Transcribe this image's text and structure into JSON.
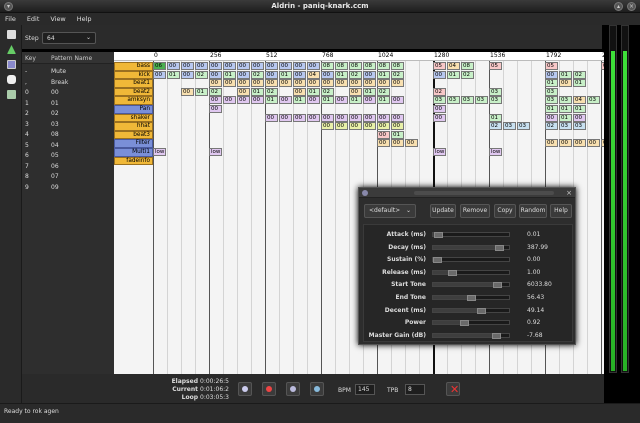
{
  "window": {
    "title": "Aldrin - paniq-knark.ccm"
  },
  "menu": [
    "File",
    "Edit",
    "View",
    "Help"
  ],
  "step": {
    "label": "Step",
    "value": "64"
  },
  "pattern_list": {
    "headers": {
      "key": "Key",
      "name": "Pattern Name"
    },
    "rows": [
      {
        "key": "-",
        "name": "Mute"
      },
      {
        "key": ",",
        "name": "Break"
      },
      {
        "key": "0",
        "name": "00"
      },
      {
        "key": "1",
        "name": "01"
      },
      {
        "key": "2",
        "name": "02"
      },
      {
        "key": "3",
        "name": "03"
      },
      {
        "key": "4",
        "name": "08"
      },
      {
        "key": "5",
        "name": "04"
      },
      {
        "key": "6",
        "name": "05"
      },
      {
        "key": "7",
        "name": "06"
      },
      {
        "key": "8",
        "name": "07"
      },
      {
        "key": "9",
        "name": "09"
      }
    ]
  },
  "ruler": [
    "0",
    "256",
    "512",
    "768",
    "1024",
    "1280",
    "1536",
    "1792",
    "20"
  ],
  "tracks": [
    {
      "name": "bass",
      "style": "orange"
    },
    {
      "name": "kick",
      "style": "orange"
    },
    {
      "name": "beat1",
      "style": "orange"
    },
    {
      "name": "beat2",
      "style": "orange"
    },
    {
      "name": "amksyn",
      "style": "orange"
    },
    {
      "name": "Pan",
      "style": "blue"
    },
    {
      "name": "shaker",
      "style": "orange"
    },
    {
      "name": "hhat",
      "style": "orange"
    },
    {
      "name": "beat3",
      "style": "orange"
    },
    {
      "name": "Filter",
      "style": "blue"
    },
    {
      "name": "Multi1",
      "style": "blue"
    },
    {
      "name": "fadeinfo",
      "style": "orange"
    }
  ],
  "cells": [
    {
      "t": 0,
      "c": 0,
      "v": "06",
      "col": "#4caf50"
    },
    {
      "t": 0,
      "c": 1,
      "v": "00",
      "col": "#b8c8f0"
    },
    {
      "t": 0,
      "c": 2,
      "v": "00",
      "col": "#b8c8f0"
    },
    {
      "t": 0,
      "c": 3,
      "v": "00",
      "col": "#b8c8f0"
    },
    {
      "t": 0,
      "c": 4,
      "v": "00",
      "col": "#b8c8f0"
    },
    {
      "t": 0,
      "c": 5,
      "v": "00",
      "col": "#b8c8f0"
    },
    {
      "t": 0,
      "c": 6,
      "v": "00",
      "col": "#b8c8f0"
    },
    {
      "t": 0,
      "c": 7,
      "v": "00",
      "col": "#b8c8f0"
    },
    {
      "t": 0,
      "c": 8,
      "v": "00",
      "col": "#b8c8f0"
    },
    {
      "t": 0,
      "c": 9,
      "v": "00",
      "col": "#b8c8f0"
    },
    {
      "t": 0,
      "c": 10,
      "v": "00",
      "col": "#b8c8f0"
    },
    {
      "t": 0,
      "c": 11,
      "v": "00",
      "col": "#b8c8f0"
    },
    {
      "t": 0,
      "c": 12,
      "v": "08",
      "col": "#c8f0c8"
    },
    {
      "t": 0,
      "c": 13,
      "v": "08",
      "col": "#c8f0c8"
    },
    {
      "t": 0,
      "c": 14,
      "v": "08",
      "col": "#c8f0c8"
    },
    {
      "t": 0,
      "c": 15,
      "v": "08",
      "col": "#c8f0c8"
    },
    {
      "t": 0,
      "c": 16,
      "v": "08",
      "col": "#c8f0c8"
    },
    {
      "t": 0,
      "c": 17,
      "v": "08",
      "col": "#c8f0c8"
    },
    {
      "t": 0,
      "c": 20,
      "v": "05",
      "col": "#f8c8c8"
    },
    {
      "t": 0,
      "c": 21,
      "v": "04",
      "col": "#f8e0b0"
    },
    {
      "t": 0,
      "c": 22,
      "v": "08",
      "col": "#c8f0c8"
    },
    {
      "t": 0,
      "c": 24,
      "v": "05",
      "col": "#f8c8c8"
    },
    {
      "t": 0,
      "c": 28,
      "v": "05",
      "col": "#f8c8c8"
    },
    {
      "t": 0,
      "c": 32,
      "v": "05",
      "col": "#f8c8c8"
    },
    {
      "t": 1,
      "c": 0,
      "v": "00",
      "col": "#b8c8f0"
    },
    {
      "t": 1,
      "c": 1,
      "v": "01",
      "col": "#c8f0c8"
    },
    {
      "t": 1,
      "c": 2,
      "v": "00",
      "col": "#b8c8f0"
    },
    {
      "t": 1,
      "c": 3,
      "v": "02",
      "col": "#c8f0c8"
    },
    {
      "t": 1,
      "c": 4,
      "v": "00",
      "col": "#b8c8f0"
    },
    {
      "t": 1,
      "c": 5,
      "v": "01",
      "col": "#c8f0c8"
    },
    {
      "t": 1,
      "c": 6,
      "v": "00",
      "col": "#b8c8f0"
    },
    {
      "t": 1,
      "c": 7,
      "v": "02",
      "col": "#c8f0c8"
    },
    {
      "t": 1,
      "c": 8,
      "v": "00",
      "col": "#b8c8f0"
    },
    {
      "t": 1,
      "c": 9,
      "v": "01",
      "col": "#c8f0c8"
    },
    {
      "t": 1,
      "c": 10,
      "v": "00",
      "col": "#b8c8f0"
    },
    {
      "t": 1,
      "c": 11,
      "v": "04",
      "col": "#f8e0b0"
    },
    {
      "t": 1,
      "c": 12,
      "v": "00",
      "col": "#b8c8f0"
    },
    {
      "t": 1,
      "c": 13,
      "v": "01",
      "col": "#c8f0c8"
    },
    {
      "t": 1,
      "c": 14,
      "v": "02",
      "col": "#c8f0c8"
    },
    {
      "t": 1,
      "c": 15,
      "v": "00",
      "col": "#b8c8f0"
    },
    {
      "t": 1,
      "c": 16,
      "v": "01",
      "col": "#c8f0c8"
    },
    {
      "t": 1,
      "c": 17,
      "v": "02",
      "col": "#c8f0c8"
    },
    {
      "t": 1,
      "c": 20,
      "v": "00",
      "col": "#b8c8f0"
    },
    {
      "t": 1,
      "c": 21,
      "v": "01",
      "col": "#c8f0c8"
    },
    {
      "t": 1,
      "c": 22,
      "v": "02",
      "col": "#c8f0c8"
    },
    {
      "t": 1,
      "c": 28,
      "v": "00",
      "col": "#b8c8f0"
    },
    {
      "t": 1,
      "c": 29,
      "v": "01",
      "col": "#c8f0c8"
    },
    {
      "t": 1,
      "c": 30,
      "v": "02",
      "col": "#c8f0c8"
    },
    {
      "t": 2,
      "c": 4,
      "v": "00",
      "col": "#f8e0b0"
    },
    {
      "t": 2,
      "c": 5,
      "v": "00",
      "col": "#f8e0b0"
    },
    {
      "t": 2,
      "c": 6,
      "v": "00",
      "col": "#f8e0b0"
    },
    {
      "t": 2,
      "c": 7,
      "v": "00",
      "col": "#f8e0b0"
    },
    {
      "t": 2,
      "c": 8,
      "v": "00",
      "col": "#f8e0b0"
    },
    {
      "t": 2,
      "c": 9,
      "v": "00",
      "col": "#f8e0b0"
    },
    {
      "t": 2,
      "c": 10,
      "v": "00",
      "col": "#f8e0b0"
    },
    {
      "t": 2,
      "c": 11,
      "v": "00",
      "col": "#f8e0b0"
    },
    {
      "t": 2,
      "c": 12,
      "v": "00",
      "col": "#f8e0b0"
    },
    {
      "t": 2,
      "c": 13,
      "v": "00",
      "col": "#f8e0b0"
    },
    {
      "t": 2,
      "c": 14,
      "v": "00",
      "col": "#f8e0b0"
    },
    {
      "t": 2,
      "c": 15,
      "v": "00",
      "col": "#f8e0b0"
    },
    {
      "t": 2,
      "c": 16,
      "v": "00",
      "col": "#f8e0b0"
    },
    {
      "t": 2,
      "c": 17,
      "v": "00",
      "col": "#f8e0b0"
    },
    {
      "t": 2,
      "c": 28,
      "v": "01",
      "col": "#c8f0c8"
    },
    {
      "t": 2,
      "c": 29,
      "v": "00",
      "col": "#f8e0b0"
    },
    {
      "t": 2,
      "c": 30,
      "v": "01",
      "col": "#c8f0c8"
    },
    {
      "t": 3,
      "c": 2,
      "v": "00",
      "col": "#f8e0b0"
    },
    {
      "t": 3,
      "c": 3,
      "v": "01",
      "col": "#c8f0c8"
    },
    {
      "t": 3,
      "c": 4,
      "v": "02",
      "col": "#c8f0c8"
    },
    {
      "t": 3,
      "c": 6,
      "v": "00",
      "col": "#f8e0b0"
    },
    {
      "t": 3,
      "c": 7,
      "v": "01",
      "col": "#c8f0c8"
    },
    {
      "t": 3,
      "c": 8,
      "v": "02",
      "col": "#c8f0c8"
    },
    {
      "t": 3,
      "c": 10,
      "v": "00",
      "col": "#f8e0b0"
    },
    {
      "t": 3,
      "c": 11,
      "v": "01",
      "col": "#c8f0c8"
    },
    {
      "t": 3,
      "c": 12,
      "v": "02",
      "col": "#c8f0c8"
    },
    {
      "t": 3,
      "c": 14,
      "v": "00",
      "col": "#f8e0b0"
    },
    {
      "t": 3,
      "c": 15,
      "v": "01",
      "col": "#c8f0c8"
    },
    {
      "t": 3,
      "c": 16,
      "v": "02",
      "col": "#c8f0c8"
    },
    {
      "t": 3,
      "c": 20,
      "v": "02",
      "col": "#f8c8c8"
    },
    {
      "t": 3,
      "c": 24,
      "v": "03",
      "col": "#c8f0c8"
    },
    {
      "t": 3,
      "c": 28,
      "v": "03",
      "col": "#c8f0c8"
    },
    {
      "t": 4,
      "c": 4,
      "v": "00",
      "col": "#e0c8f0"
    },
    {
      "t": 4,
      "c": 5,
      "v": "00",
      "col": "#e0c8f0"
    },
    {
      "t": 4,
      "c": 6,
      "v": "00",
      "col": "#e0c8f0"
    },
    {
      "t": 4,
      "c": 7,
      "v": "00",
      "col": "#e0c8f0"
    },
    {
      "t": 4,
      "c": 8,
      "v": "01",
      "col": "#c8f0c8"
    },
    {
      "t": 4,
      "c": 9,
      "v": "00",
      "col": "#e0c8f0"
    },
    {
      "t": 4,
      "c": 10,
      "v": "01",
      "col": "#c8f0c8"
    },
    {
      "t": 4,
      "c": 11,
      "v": "00",
      "col": "#e0c8f0"
    },
    {
      "t": 4,
      "c": 12,
      "v": "01",
      "col": "#c8f0c8"
    },
    {
      "t": 4,
      "c": 13,
      "v": "00",
      "col": "#e0c8f0"
    },
    {
      "t": 4,
      "c": 14,
      "v": "01",
      "col": "#c8f0c8"
    },
    {
      "t": 4,
      "c": 15,
      "v": "00",
      "col": "#e0c8f0"
    },
    {
      "t": 4,
      "c": 16,
      "v": "01",
      "col": "#c8f0c8"
    },
    {
      "t": 4,
      "c": 17,
      "v": "00",
      "col": "#e0c8f0"
    },
    {
      "t": 4,
      "c": 20,
      "v": "03",
      "col": "#c8f0c8"
    },
    {
      "t": 4,
      "c": 21,
      "v": "03",
      "col": "#c8f0c8"
    },
    {
      "t": 4,
      "c": 22,
      "v": "03",
      "col": "#c8f0c8"
    },
    {
      "t": 4,
      "c": 23,
      "v": "03",
      "col": "#c8f0c8"
    },
    {
      "t": 4,
      "c": 24,
      "v": "03",
      "col": "#c8f0c8"
    },
    {
      "t": 4,
      "c": 28,
      "v": "03",
      "col": "#c8f0c8"
    },
    {
      "t": 4,
      "c": 29,
      "v": "03",
      "col": "#c8f0c8"
    },
    {
      "t": 4,
      "c": 30,
      "v": "04",
      "col": "#f8e0b0"
    },
    {
      "t": 4,
      "c": 31,
      "v": "03",
      "col": "#c8f0c8"
    },
    {
      "t": 5,
      "c": 4,
      "v": "00",
      "col": "#e0c8f0"
    },
    {
      "t": 5,
      "c": 20,
      "v": "00",
      "col": "#e0c8f0"
    },
    {
      "t": 5,
      "c": 28,
      "v": "01",
      "col": "#c8f0c8"
    },
    {
      "t": 5,
      "c": 29,
      "v": "01",
      "col": "#c8f0c8"
    },
    {
      "t": 5,
      "c": 30,
      "v": "01",
      "col": "#c8f0c8"
    },
    {
      "t": 6,
      "c": 8,
      "v": "00",
      "col": "#e0c8f0"
    },
    {
      "t": 6,
      "c": 9,
      "v": "00",
      "col": "#e0c8f0"
    },
    {
      "t": 6,
      "c": 10,
      "v": "00",
      "col": "#e0c8f0"
    },
    {
      "t": 6,
      "c": 11,
      "v": "00",
      "col": "#e0c8f0"
    },
    {
      "t": 6,
      "c": 12,
      "v": "00",
      "col": "#e0c8f0"
    },
    {
      "t": 6,
      "c": 13,
      "v": "00",
      "col": "#e0c8f0"
    },
    {
      "t": 6,
      "c": 14,
      "v": "00",
      "col": "#e0c8f0"
    },
    {
      "t": 6,
      "c": 15,
      "v": "00",
      "col": "#e0c8f0"
    },
    {
      "t": 6,
      "c": 16,
      "v": "00",
      "col": "#e0c8f0"
    },
    {
      "t": 6,
      "c": 17,
      "v": "00",
      "col": "#e0c8f0"
    },
    {
      "t": 6,
      "c": 20,
      "v": "00",
      "col": "#e0c8f0"
    },
    {
      "t": 6,
      "c": 24,
      "v": "01",
      "col": "#c8f0c8"
    },
    {
      "t": 6,
      "c": 28,
      "v": "00",
      "col": "#e0c8f0"
    },
    {
      "t": 6,
      "c": 29,
      "v": "01",
      "col": "#c8f0c8"
    },
    {
      "t": 6,
      "c": 30,
      "v": "00",
      "col": "#e0c8f0"
    },
    {
      "t": 7,
      "c": 12,
      "v": "00",
      "col": "#e8f0a8"
    },
    {
      "t": 7,
      "c": 13,
      "v": "00",
      "col": "#e8f0a8"
    },
    {
      "t": 7,
      "c": 14,
      "v": "00",
      "col": "#e8f0a8"
    },
    {
      "t": 7,
      "c": 15,
      "v": "00",
      "col": "#e8f0a8"
    },
    {
      "t": 7,
      "c": 16,
      "v": "00",
      "col": "#e8f0a8"
    },
    {
      "t": 7,
      "c": 17,
      "v": "00",
      "col": "#e8f0a8"
    },
    {
      "t": 7,
      "c": 24,
      "v": "02",
      "col": "#c8e0f0"
    },
    {
      "t": 7,
      "c": 25,
      "v": "03",
      "col": "#c8e0f0"
    },
    {
      "t": 7,
      "c": 26,
      "v": "03",
      "col": "#c8e0f0"
    },
    {
      "t": 7,
      "c": 28,
      "v": "02",
      "col": "#c8e0f0"
    },
    {
      "t": 7,
      "c": 29,
      "v": "03",
      "col": "#c8e0f0"
    },
    {
      "t": 7,
      "c": 30,
      "v": "03",
      "col": "#c8e0f0"
    },
    {
      "t": 8,
      "c": 16,
      "v": "00",
      "col": "#f8c8c8"
    },
    {
      "t": 8,
      "c": 17,
      "v": "01",
      "col": "#c8f0c8"
    },
    {
      "t": 9,
      "c": 16,
      "v": "00",
      "col": "#f8e0b0"
    },
    {
      "t": 9,
      "c": 17,
      "v": "00",
      "col": "#f8e0b0"
    },
    {
      "t": 9,
      "c": 18,
      "v": "00",
      "col": "#f8e0b0"
    },
    {
      "t": 9,
      "c": 28,
      "v": "00",
      "col": "#f8e0b0"
    },
    {
      "t": 9,
      "c": 29,
      "v": "00",
      "col": "#f8e0b0"
    },
    {
      "t": 9,
      "c": 30,
      "v": "00",
      "col": "#f8e0b0"
    },
    {
      "t": 9,
      "c": 31,
      "v": "00",
      "col": "#f8e0b0"
    },
    {
      "t": 9,
      "c": 32,
      "v": "00",
      "col": "#f8e0b0"
    },
    {
      "t": 10,
      "c": 0,
      "v": "low",
      "col": "#e0c8f0"
    },
    {
      "t": 10,
      "c": 4,
      "v": "low",
      "col": "#e0c8f0"
    },
    {
      "t": 10,
      "c": 20,
      "v": "low",
      "col": "#e0c8f0"
    },
    {
      "t": 10,
      "c": 24,
      "v": "low",
      "col": "#e0c8f0"
    }
  ],
  "dialog": {
    "preset": "<default>",
    "buttons": [
      "Update",
      "Remove",
      "Copy",
      "Random",
      "Help"
    ],
    "params": [
      {
        "name": "Attack (ms)",
        "value": "0.01",
        "frac": 0.02
      },
      {
        "name": "Decay (ms)",
        "value": "387.99",
        "frac": 0.92
      },
      {
        "name": "Sustain (%)",
        "value": "0.00",
        "frac": 0.0
      },
      {
        "name": "Release (ms)",
        "value": "1.00",
        "frac": 0.22
      },
      {
        "name": "Start Tone",
        "value": "6033.80",
        "frac": 0.9
      },
      {
        "name": "End Tone",
        "value": "56.43",
        "frac": 0.5
      },
      {
        "name": "Decent (ms)",
        "value": "49.14",
        "frac": 0.66
      },
      {
        "name": "Power",
        "value": "0.92",
        "frac": 0.4
      },
      {
        "name": "Master Gain (dB)",
        "value": "-7.68",
        "frac": 0.88
      }
    ]
  },
  "transport": {
    "elapsed_label": "Elapsed",
    "elapsed": "0:00:26:5",
    "current_label": "Current",
    "current": "0:01:06:2",
    "loop_label": "Loop",
    "loop": "0:03:05:3",
    "bpm_label": "BPM",
    "bpm": "145",
    "tpb_label": "TPB",
    "tpb": "8"
  },
  "status": "Ready to rok agen",
  "vu": {
    "left": 0.93,
    "right": 0.93
  }
}
